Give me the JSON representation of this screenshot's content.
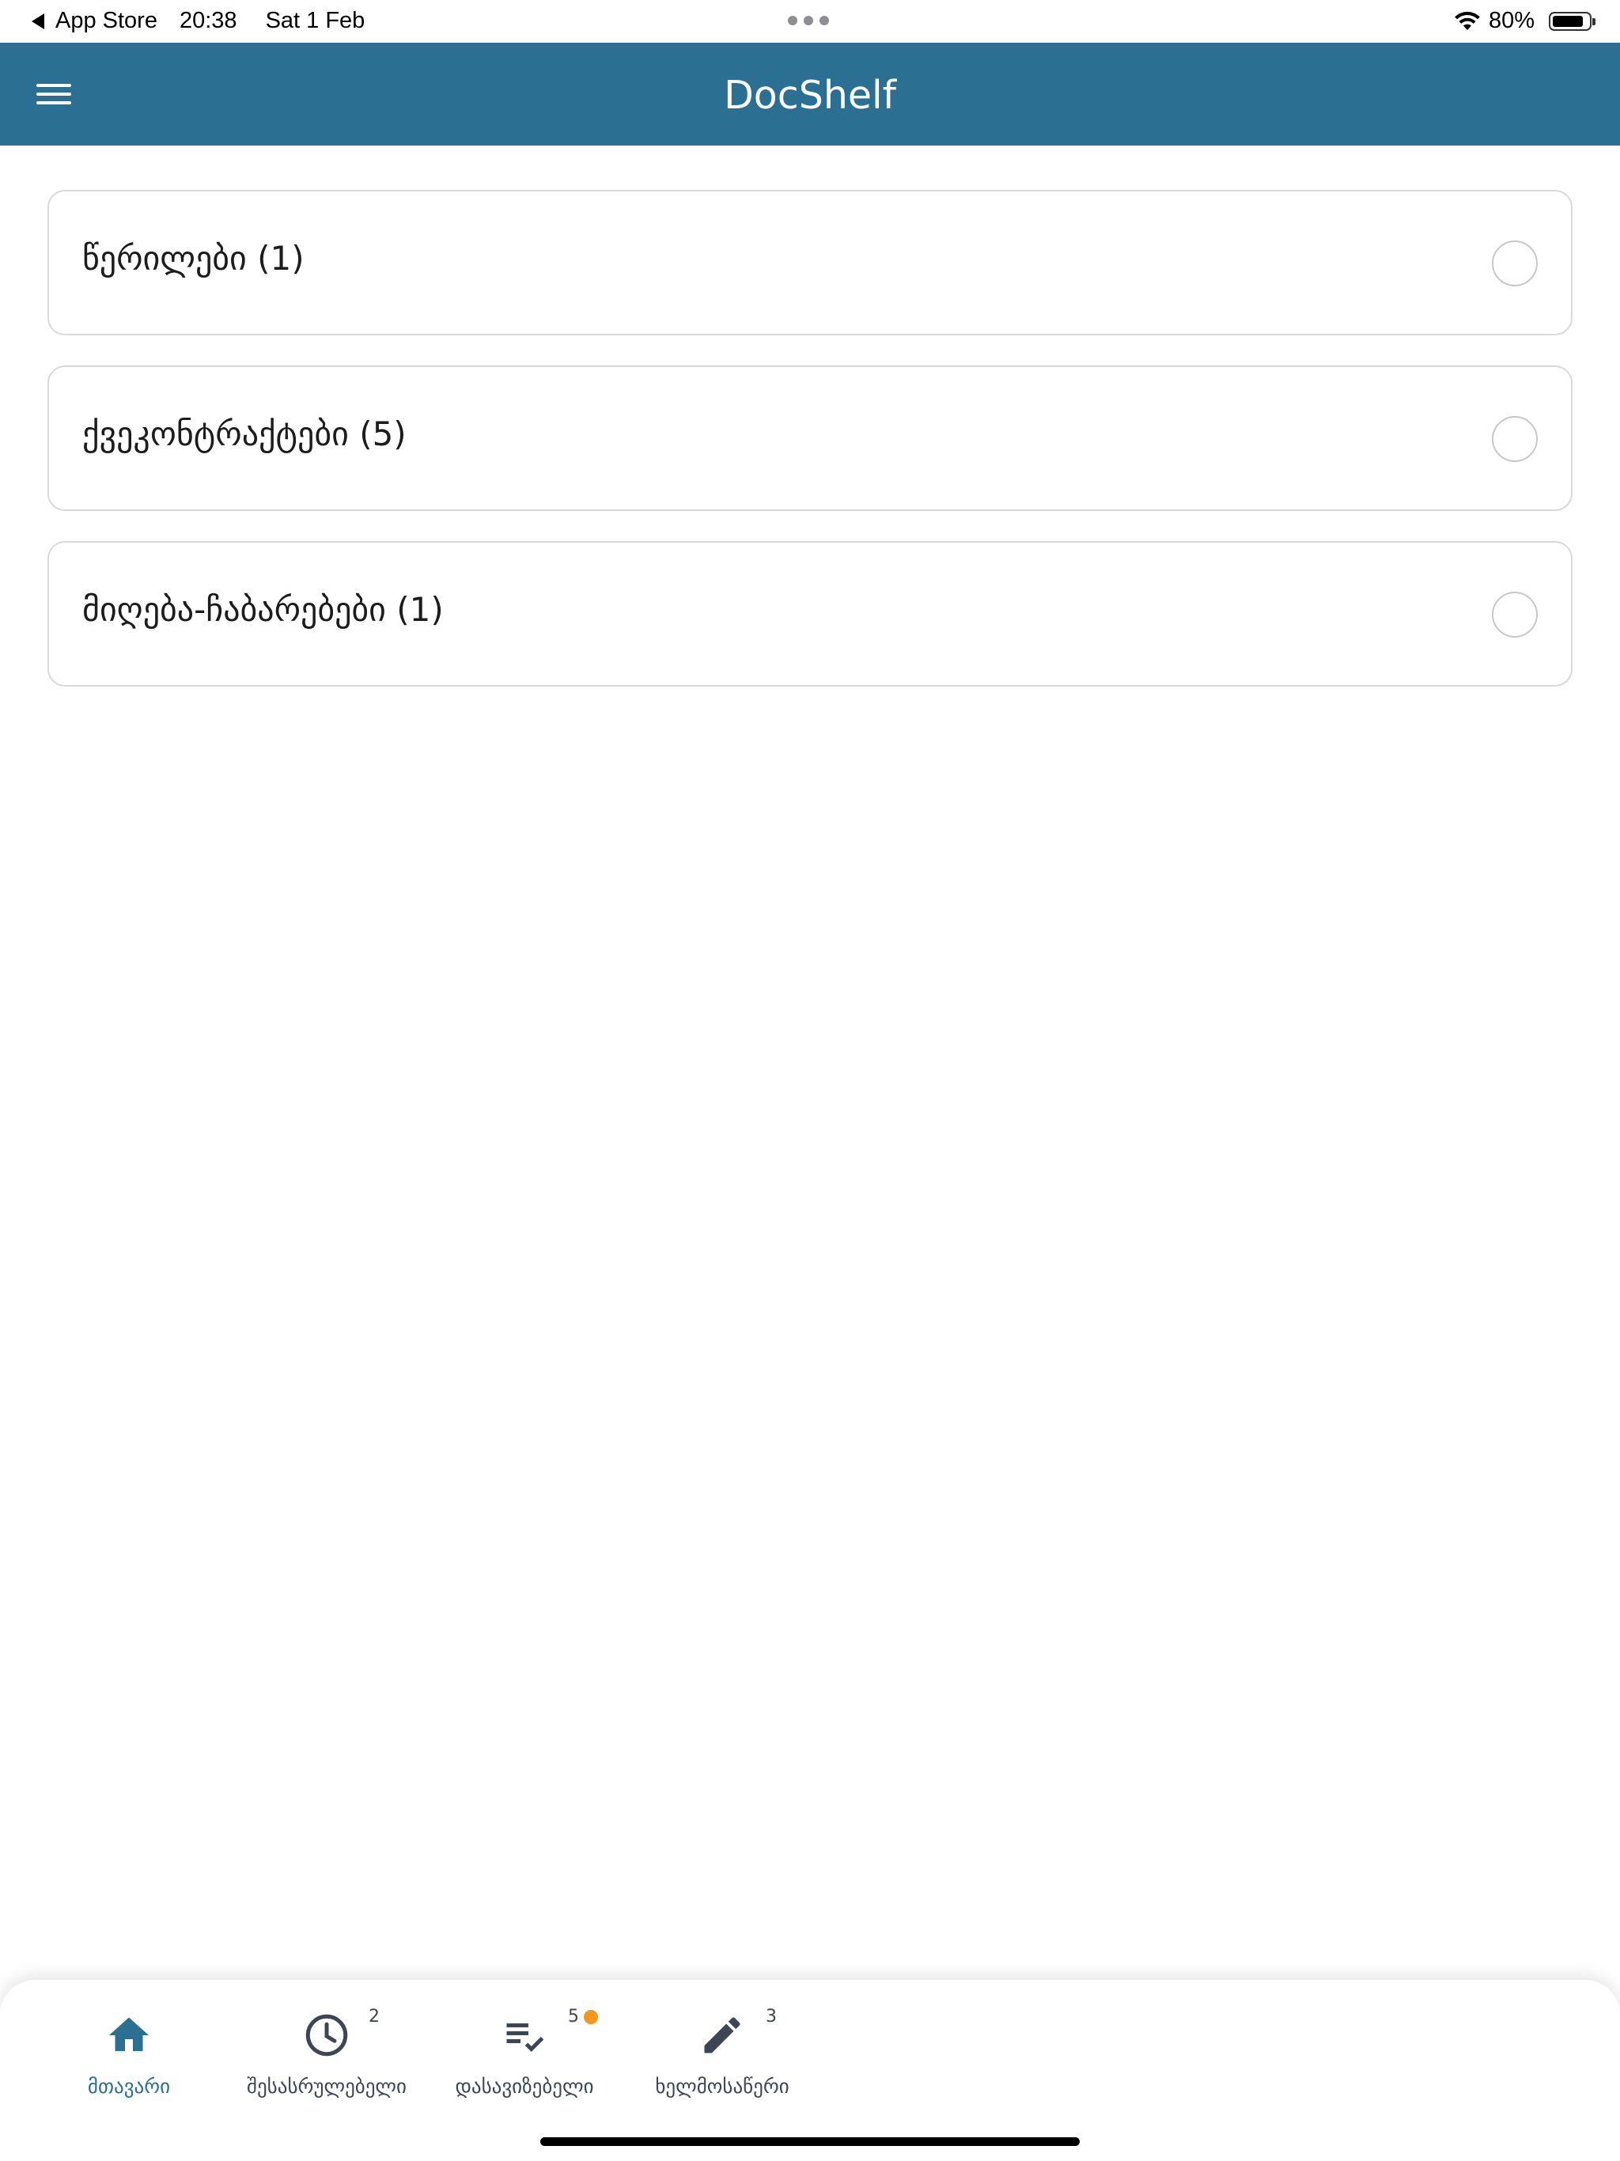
{
  "status_bar": {
    "back_app": "App Store",
    "time": "20:38",
    "date": "Sat 1 Feb",
    "battery": "80%",
    "battery_level": 0.8
  },
  "header": {
    "title": "DocShelf",
    "menu_icon": "menu-icon",
    "background": "#2b6f93"
  },
  "cards": [
    {
      "label": "წერილები (1)"
    },
    {
      "label": "ქვეკონტრაქტები (5)"
    },
    {
      "label": "მიღება-ჩაბარებები (1)"
    }
  ],
  "tabs": [
    {
      "label": "მთავარი",
      "icon": "home-icon",
      "badge": "",
      "active": true
    },
    {
      "label": "შესასრულებელი",
      "icon": "clock-icon",
      "badge": "2"
    },
    {
      "label": "დასავიზებელი",
      "icon": "playlist-check-icon",
      "badge": "5",
      "dot": true
    },
    {
      "label": "ხელმოსაწერი",
      "icon": "pencil-icon",
      "badge": "3"
    }
  ],
  "colors": {
    "accent": "#2b6f93",
    "badge_dot": "#f5961d",
    "tab_inactive": "#3e4554"
  }
}
